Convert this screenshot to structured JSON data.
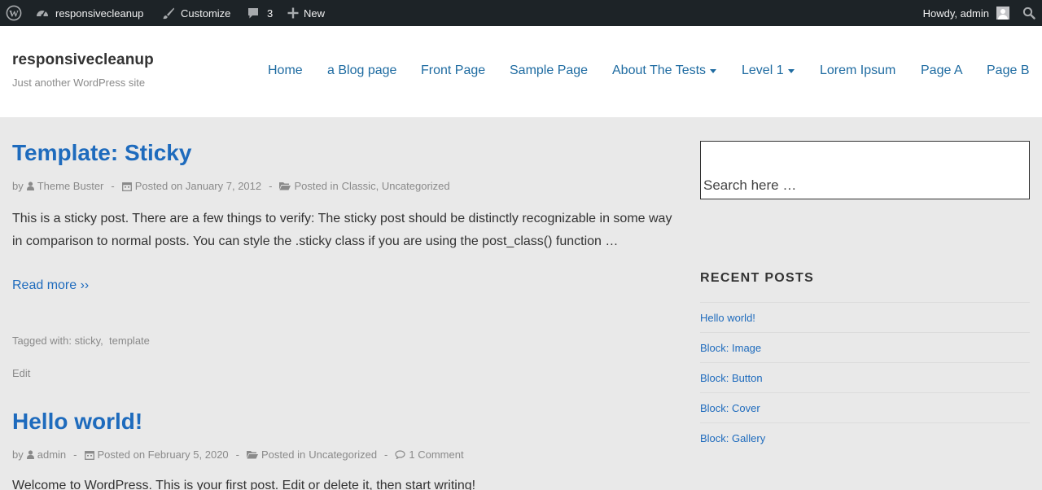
{
  "admin_bar": {
    "site_name": "responsivecleanup",
    "customize": "Customize",
    "comments_count": "3",
    "new": "New",
    "howdy": "Howdy, admin",
    "icons": [
      "wordpress-icon",
      "dashboard-icon",
      "brush-icon",
      "comment-icon",
      "plus-icon",
      "avatar",
      "search-icon"
    ]
  },
  "header": {
    "site_title": "responsivecleanup",
    "tagline": "Just another WordPress site",
    "nav": [
      {
        "label": "Home"
      },
      {
        "label": "a Blog page"
      },
      {
        "label": "Front Page"
      },
      {
        "label": "Sample Page"
      },
      {
        "label": "About The Tests",
        "has_dropdown": true
      },
      {
        "label": "Level 1",
        "has_dropdown": true
      },
      {
        "label": "Lorem Ipsum"
      },
      {
        "label": "Page A"
      },
      {
        "label": "Page B"
      }
    ]
  },
  "posts": [
    {
      "title": "Template: Sticky",
      "by": "by",
      "author": "Theme Buster",
      "posted_on": "Posted on January 7, 2012",
      "posted_in_label": "Posted in",
      "categories": [
        "Classic",
        "Uncategorized"
      ],
      "excerpt": "This is a sticky post. There are a few things to verify: The sticky post should be distinctly recognizable in some way in comparison to normal posts. You can style the .sticky class if you are using the post_class() function …",
      "read_more": "Read more ››",
      "tagged_label": "Tagged with:",
      "tags": [
        "sticky",
        "template"
      ],
      "edit": "Edit"
    },
    {
      "title": "Hello world!",
      "by": "by",
      "author": "admin",
      "posted_on": "Posted on February 5, 2020",
      "posted_in_label": "Posted in",
      "categories": [
        "Uncategorized"
      ],
      "comments": "1 Comment",
      "excerpt": "Welcome to WordPress. This is your first post. Edit or delete it, then start writing!"
    }
  ],
  "sidebar": {
    "search_placeholder": "Search here …",
    "recent_posts_title": "RECENT POSTS",
    "recent_posts": [
      "Hello world!",
      "Block: Image",
      "Block: Button",
      "Block: Cover",
      "Block: Gallery"
    ]
  },
  "colors": {
    "admin_bar_bg": "#1d2327",
    "link": "#1e6bbd",
    "nav_link": "#1e6ba1",
    "page_bg": "#e9e9e9",
    "meta_text": "#8a8a8a"
  }
}
